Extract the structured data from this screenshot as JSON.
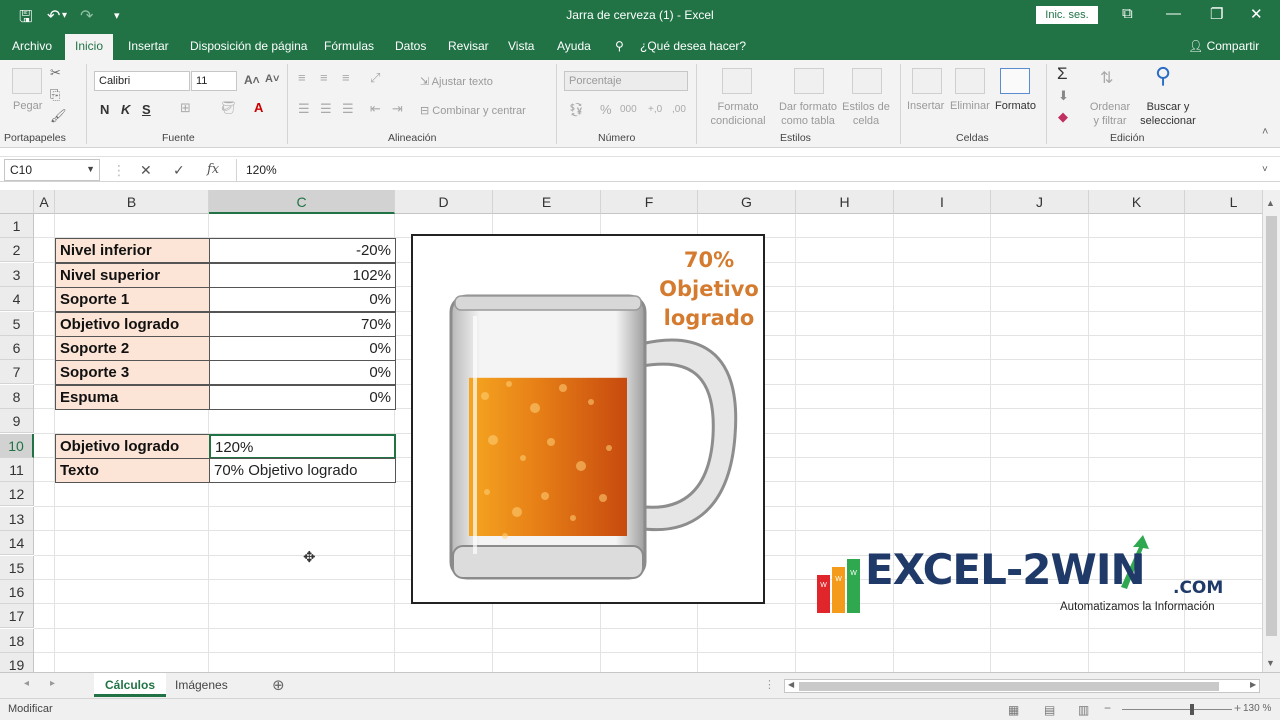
{
  "window": {
    "title": "Jarra de cerveza (1)  -  Excel",
    "signin_label": "Inic. ses."
  },
  "tabs": [
    "Archivo",
    "Inicio",
    "Insertar",
    "Disposición de página",
    "Fórmulas",
    "Datos",
    "Revisar",
    "Vista",
    "Ayuda",
    "¿Qué desea hacer?"
  ],
  "share_label": "Compartir",
  "ribbon": {
    "portapapeles": {
      "paste": "Pegar",
      "label": "Portapapeles"
    },
    "fuente": {
      "font": "Calibri",
      "size": "11",
      "bold": "N",
      "italic": "K",
      "underline": "S",
      "label": "Fuente"
    },
    "alineacion": {
      "wrap": "Ajustar texto",
      "merge": "Combinar y centrar",
      "label": "Alineación"
    },
    "numero": {
      "format": "Porcentaje",
      "label": "Número"
    },
    "estilos": {
      "cond": "Formato condicional",
      "table": "Dar formato como tabla",
      "cell": "Estilos de celda",
      "label": "Estilos"
    },
    "celdas": {
      "insert": "Insertar",
      "delete": "Eliminar",
      "format": "Formato",
      "label": "Celdas"
    },
    "edicion": {
      "sort": "Ordenar y filtrar",
      "find": "Buscar y seleccionar",
      "label": "Edición"
    }
  },
  "formula_bar": {
    "name_box": "C10",
    "fx": "fx",
    "value": "120%"
  },
  "columns": [
    "A",
    "B",
    "C",
    "D",
    "E",
    "F",
    "G",
    "H",
    "I",
    "J",
    "K",
    "L"
  ],
  "rows": [
    "1",
    "2",
    "3",
    "4",
    "5",
    "6",
    "7",
    "8",
    "9",
    "10",
    "11",
    "12",
    "13",
    "14",
    "15",
    "16",
    "17",
    "18",
    "19"
  ],
  "table1": [
    {
      "label": "Nivel inferior",
      "value": "-20%"
    },
    {
      "label": "Nivel superior",
      "value": "102%"
    },
    {
      "label": "Soporte 1",
      "value": "0%"
    },
    {
      "label": "Objetivo logrado",
      "value": "70%"
    },
    {
      "label": "Soporte 2",
      "value": "0%"
    },
    {
      "label": "Soporte 3",
      "value": "0%"
    },
    {
      "label": "Espuma",
      "value": "0%"
    }
  ],
  "table2": [
    {
      "label": "Objetivo logrado",
      "value": "120%"
    },
    {
      "label": "Texto",
      "value": "70% Objetivo logrado"
    }
  ],
  "chart": {
    "annotation": [
      "70%",
      "Objetivo",
      "logrado"
    ],
    "fill_fraction": 0.7
  },
  "logo": {
    "word": "EXCEL-2WIN",
    "dotcom": ".COM",
    "tagline": "Automatizamos la Información",
    "bar_letters": [
      "W",
      "W",
      "W"
    ]
  },
  "sheets": [
    "Cálculos",
    "Imágenes"
  ],
  "status": {
    "mode": "Modificar",
    "zoom": "130 %"
  },
  "colors": {
    "excel_green": "#217346",
    "label_fill": "#fce4d6",
    "beer_light": "#f5a520",
    "beer_dark": "#c74a0e",
    "annotation": "#d47b2f",
    "logo_navy": "#1f3a68"
  }
}
